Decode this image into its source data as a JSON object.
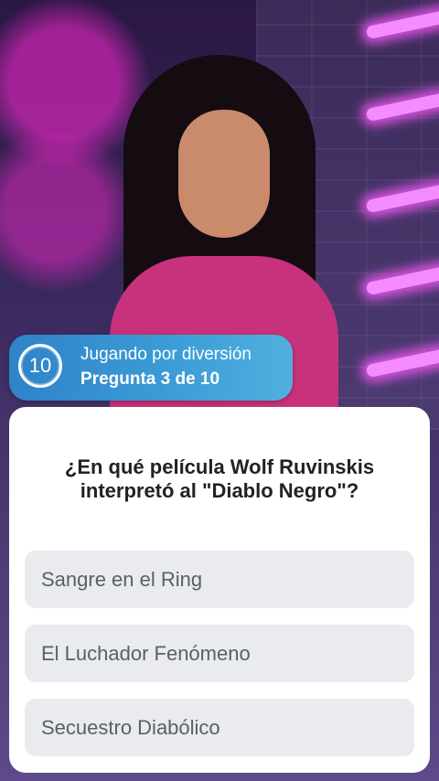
{
  "hud": {
    "timer_value": "10",
    "mode_label": "Jugando por diversión",
    "progress_label": "Pregunta 3 de 10"
  },
  "quiz": {
    "question": "¿En qué película Wolf Ruvinskis interpretó al \"Diablo Negro\"?",
    "answers": [
      {
        "label": "Sangre en el Ring"
      },
      {
        "label": "El Luchador Fenómeno"
      },
      {
        "label": "Secuestro Diabólico"
      }
    ]
  },
  "colors": {
    "hud_gradient_start": "#2f83c8",
    "hud_gradient_end": "#4fb0df",
    "card_bg": "#ffffff",
    "answer_bg": "#e9ebee"
  }
}
